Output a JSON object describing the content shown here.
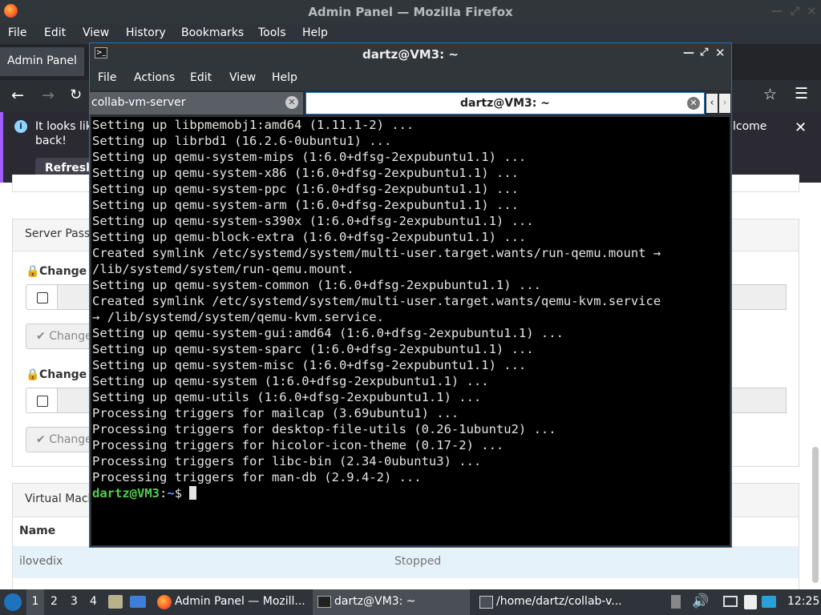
{
  "firefox": {
    "title": "Admin Panel — Mozilla Firefox",
    "menu": [
      "File",
      "Edit",
      "View",
      "History",
      "Bookmarks",
      "Tools",
      "Help"
    ],
    "tab_title": "Admin Panel",
    "notice_text_1": "It looks lik",
    "notice_text_2": "back!",
    "notice_right": "lcome",
    "refresh_button": "Refresh"
  },
  "page": {
    "server_password_header": "Server Passw",
    "change_label_1": "Change M",
    "change_button_1": "Change",
    "change_label_2": "Change M",
    "change_button_2": "Change",
    "virtual_machines_header": "Virtual Mach",
    "table_header_name": "Name",
    "row_name": "ilovedix",
    "row_status": "Stopped"
  },
  "terminal": {
    "title": "dartz@VM3: ~",
    "menu": [
      "File",
      "Actions",
      "Edit",
      "View",
      "Help"
    ],
    "tab_inactive": "collab-vm-server",
    "tab_active": "dartz@VM3: ~",
    "lines": [
      "Setting up libpmemobj1:amd64 (1.11.1-2) ...",
      "Setting up librbd1 (16.2.6-0ubuntu1) ...",
      "Setting up qemu-system-mips (1:6.0+dfsg-2expubuntu1.1) ...",
      "Setting up qemu-system-x86 (1:6.0+dfsg-2expubuntu1.1) ...",
      "Setting up qemu-system-ppc (1:6.0+dfsg-2expubuntu1.1) ...",
      "Setting up qemu-system-arm (1:6.0+dfsg-2expubuntu1.1) ...",
      "Setting up qemu-system-s390x (1:6.0+dfsg-2expubuntu1.1) ...",
      "Setting up qemu-block-extra (1:6.0+dfsg-2expubuntu1.1) ...",
      "Created symlink /etc/systemd/system/multi-user.target.wants/run-qemu.mount →",
      "/lib/systemd/system/run-qemu.mount.",
      "Setting up qemu-system-common (1:6.0+dfsg-2expubuntu1.1) ...",
      "Created symlink /etc/systemd/system/multi-user.target.wants/qemu-kvm.service",
      "→ /lib/systemd/system/qemu-kvm.service.",
      "Setting up qemu-system-gui:amd64 (1:6.0+dfsg-2expubuntu1.1) ...",
      "Setting up qemu-system-sparc (1:6.0+dfsg-2expubuntu1.1) ...",
      "Setting up qemu-system-misc (1:6.0+dfsg-2expubuntu1.1) ...",
      "Setting up qemu-system (1:6.0+dfsg-2expubuntu1.1) ...",
      "Setting up qemu-utils (1:6.0+dfsg-2expubuntu1.1) ...",
      "Processing triggers for mailcap (3.69ubuntu1) ...",
      "Processing triggers for desktop-file-utils (0.26-1ubuntu2) ...",
      "Processing triggers for hicolor-icon-theme (0.17-2) ...",
      "Processing triggers for libc-bin (2.34-0ubuntu3) ...",
      "Processing triggers for man-db (2.9.4-2) ..."
    ],
    "prompt_user": "dartz@VM3",
    "prompt_sep": ":",
    "prompt_path": "~",
    "prompt_symbol": "$ "
  },
  "taskbar": {
    "workspaces": [
      "1",
      "2",
      "3",
      "4"
    ],
    "task_firefox": "Admin Panel — Mozill...",
    "task_terminal": "dartz@VM3: ~",
    "task_files": "/home/dartz/collab-v...",
    "clock": "12:25"
  },
  "colors": {
    "accent": "#1e73be",
    "terminal_bg": "#000000",
    "prompt_green": "#4ed04e",
    "prompt_blue": "#5f9cff"
  }
}
